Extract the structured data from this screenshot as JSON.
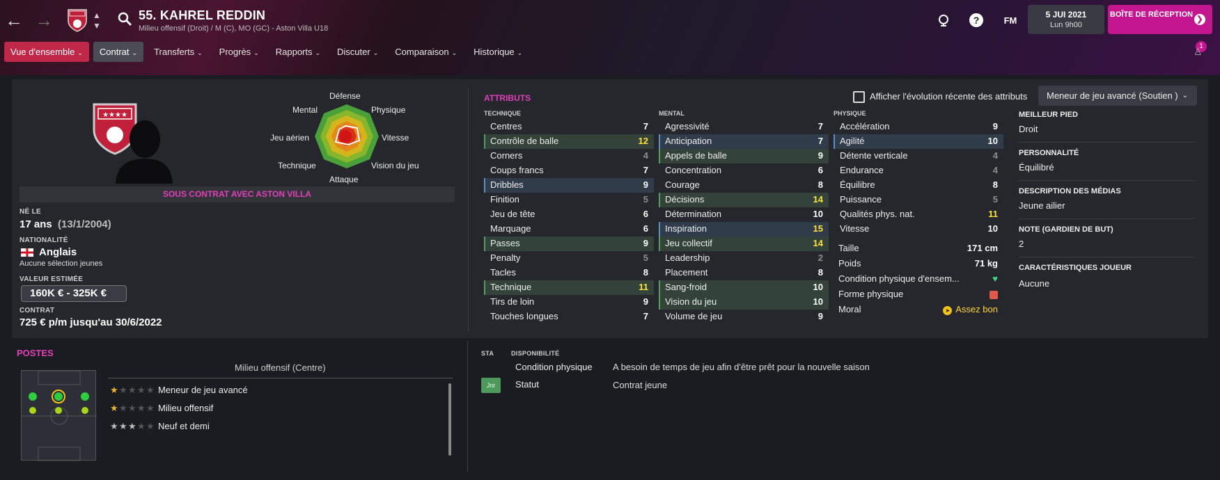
{
  "header": {
    "player_name": "55. KAHREL REDDIN",
    "player_sub": "Milieu offensif (Droit) / M (C), MO (GC) - Aston Villa U18",
    "fm_label": "FM",
    "date": "5 JUI 2021",
    "time": "Lun 9h00",
    "inbox_label": "BOÎTE DE RÉCEPTION",
    "notif_count": "1"
  },
  "menu": [
    {
      "label": "Vue d'ensemble"
    },
    {
      "label": "Contrat"
    },
    {
      "label": "Transferts"
    },
    {
      "label": "Progrès"
    },
    {
      "label": "Rapports"
    },
    {
      "label": "Discuter"
    },
    {
      "label": "Comparaison"
    },
    {
      "label": "Historique"
    }
  ],
  "radar": {
    "labels": [
      "Défense",
      "Physique",
      "Vitesse",
      "Vision du jeu",
      "Attaque",
      "Technique",
      "Jeu aérien",
      "Mental"
    ]
  },
  "profile": {
    "contract_banner": "SOUS CONTRAT AVEC ASTON VILLA",
    "born_label": "NÉ LE",
    "age": "17 ans",
    "birthdate": "(13/1/2004)",
    "nationality_label": "NATIONALITÉ",
    "nationality": "Anglais",
    "caps": "Aucune sélection jeunes",
    "value_label": "VALEUR ESTIMÉE",
    "value": "160K € - 325K €",
    "contract_label": "CONTRAT",
    "contract": "725 € p/m jusqu'au 30/6/2022"
  },
  "attributes": {
    "title": "ATTRIBUTS",
    "show_evolution": "Afficher l'évolution récente des attributs",
    "role_select": "Meneur de jeu avancé (Soutien )",
    "technique_head": "TECHNIQUE",
    "mental_head": "MENTAL",
    "physique_head": "PHYSIQUE",
    "technique": [
      {
        "name": "Centres",
        "value": "7",
        "hl": "",
        "cls": ""
      },
      {
        "name": "Contrôle de balle",
        "value": "12",
        "hl": "g",
        "cls": "y"
      },
      {
        "name": "Corners",
        "value": "4",
        "hl": "",
        "cls": "dim"
      },
      {
        "name": "Coups francs",
        "value": "7",
        "hl": "",
        "cls": ""
      },
      {
        "name": "Dribbles",
        "value": "9",
        "hl": "b",
        "cls": ""
      },
      {
        "name": "Finition",
        "value": "5",
        "hl": "",
        "cls": "dim"
      },
      {
        "name": "Jeu de tête",
        "value": "6",
        "hl": "",
        "cls": ""
      },
      {
        "name": "Marquage",
        "value": "6",
        "hl": "",
        "cls": ""
      },
      {
        "name": "Passes",
        "value": "9",
        "hl": "g",
        "cls": ""
      },
      {
        "name": "Penalty",
        "value": "5",
        "hl": "",
        "cls": "dim"
      },
      {
        "name": "Tacles",
        "value": "8",
        "hl": "",
        "cls": ""
      },
      {
        "name": "Technique",
        "value": "11",
        "hl": "g",
        "cls": "y"
      },
      {
        "name": "Tirs de loin",
        "value": "9",
        "hl": "",
        "cls": ""
      },
      {
        "name": "Touches longues",
        "value": "7",
        "hl": "",
        "cls": ""
      }
    ],
    "mental": [
      {
        "name": "Agressivité",
        "value": "7",
        "hl": "",
        "cls": ""
      },
      {
        "name": "Anticipation",
        "value": "7",
        "hl": "b",
        "cls": ""
      },
      {
        "name": "Appels de balle",
        "value": "9",
        "hl": "g",
        "cls": ""
      },
      {
        "name": "Concentration",
        "value": "6",
        "hl": "",
        "cls": ""
      },
      {
        "name": "Courage",
        "value": "8",
        "hl": "",
        "cls": ""
      },
      {
        "name": "Décisions",
        "value": "14",
        "hl": "g",
        "cls": "y"
      },
      {
        "name": "Détermination",
        "value": "10",
        "hl": "",
        "cls": ""
      },
      {
        "name": "Inspiration",
        "value": "15",
        "hl": "b",
        "cls": "y"
      },
      {
        "name": "Jeu collectif",
        "value": "14",
        "hl": "g",
        "cls": "y"
      },
      {
        "name": "Leadership",
        "value": "2",
        "hl": "",
        "cls": "dim"
      },
      {
        "name": "Placement",
        "value": "8",
        "hl": "",
        "cls": ""
      },
      {
        "name": "Sang-froid",
        "value": "10",
        "hl": "g",
        "cls": ""
      },
      {
        "name": "Vision du jeu",
        "value": "10",
        "hl": "g",
        "cls": ""
      },
      {
        "name": "Volume de jeu",
        "value": "9",
        "hl": "",
        "cls": ""
      }
    ],
    "physique": [
      {
        "name": "Accélération",
        "value": "9",
        "hl": "",
        "cls": ""
      },
      {
        "name": "Agilité",
        "value": "10",
        "hl": "b",
        "cls": ""
      },
      {
        "name": "Détente verticale",
        "value": "4",
        "hl": "",
        "cls": "dim"
      },
      {
        "name": "Endurance",
        "value": "4",
        "hl": "",
        "cls": "dim"
      },
      {
        "name": "Équilibre",
        "value": "8",
        "hl": "",
        "cls": ""
      },
      {
        "name": "Puissance",
        "value": "5",
        "hl": "",
        "cls": "dim"
      },
      {
        "name": "Qualités phys. nat.",
        "value": "11",
        "hl": "",
        "cls": "y"
      },
      {
        "name": "Vitesse",
        "value": "10",
        "hl": "",
        "cls": ""
      }
    ],
    "physical_info": [
      {
        "name": "Taille",
        "value": "171 cm"
      },
      {
        "name": "Poids",
        "value": "71 kg"
      },
      {
        "name": "Condition physique d'ensem...",
        "value": ""
      },
      {
        "name": "Forme physique",
        "value": ""
      },
      {
        "name": "Moral",
        "value": "Assez bon"
      }
    ]
  },
  "info": {
    "foot_label": "MEILLEUR PIED",
    "foot": "Droit",
    "personality_label": "PERSONNALITÉ",
    "personality": "Équilibré",
    "media_label": "DESCRIPTION DES MÉDIAS",
    "media": "Jeune ailier",
    "gk_label": "NOTE (GARDIEN DE BUT)",
    "gk": "2",
    "traits_label": "CARACTÉRISTIQUES JOUEUR",
    "traits": "Aucune"
  },
  "positions": {
    "title": "POSTES",
    "main": "Milieu offensif (Centre)",
    "roles": [
      {
        "name": "Meneur de jeu avancé",
        "stars": 1,
        "type": "on"
      },
      {
        "name": "Milieu offensif",
        "stars": 1,
        "type": "on"
      },
      {
        "name": "Neuf et demi",
        "stars": 3,
        "type": "w"
      }
    ]
  },
  "availability": {
    "sta_label": "STA",
    "dispo_label": "DISPONIBILITÉ",
    "rows": [
      {
        "name": "Condition physique",
        "value": "A besoin de temps de jeu afin d'être prêt pour la nouvelle saison",
        "tag": ""
      },
      {
        "name": "Statut",
        "value": "Contrat jeune",
        "tag": "Jnr"
      }
    ]
  },
  "colors": {
    "accent": "#e040b8",
    "inbox": "#c4178f",
    "tab_active": "#c0284a",
    "highlight_yellow": "#ffe23b"
  }
}
